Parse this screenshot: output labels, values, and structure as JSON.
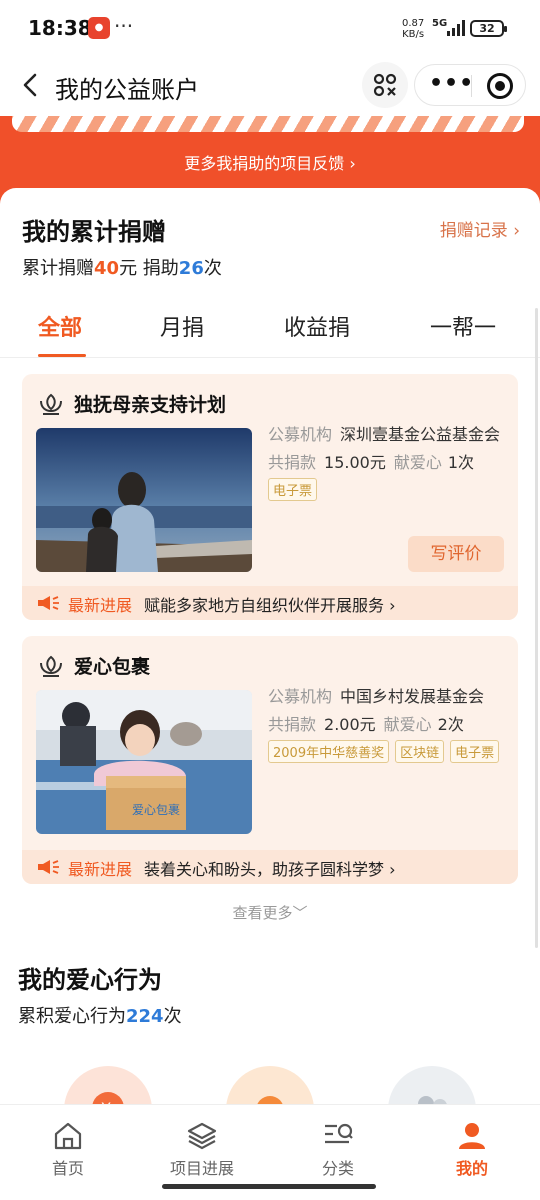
{
  "status": {
    "time": "18:38",
    "net_speed": "0.87",
    "net_unit": "KB/s",
    "net_type": "5G",
    "battery": "32",
    "dots": "···"
  },
  "nav": {
    "title": "我的公益账户",
    "back_icon": "chevron-left-icon",
    "more": "•••"
  },
  "header": {
    "feedback_link": "更多我捐助的项目反馈 ›"
  },
  "summary": {
    "title": "我的累计捐赠",
    "record_link": "捐赠记录 ›",
    "total_prefix": "累计捐赠",
    "total_amount": "40",
    "total_unit": "元",
    "times_prefix": "捐助",
    "times_count": "26",
    "times_unit": "次"
  },
  "tabs": [
    {
      "label": "全部",
      "active": true
    },
    {
      "label": "月捐",
      "active": false
    },
    {
      "label": "收益捐",
      "active": false
    },
    {
      "label": "一帮一",
      "active": false
    }
  ],
  "projects": [
    {
      "title": "独抚母亲支持计划",
      "org_label": "公募机构",
      "org_name": "深圳壹基金公益基金会",
      "donated_label": "共捐款",
      "donated_amount": "15.00元",
      "love_label": "献爱心",
      "love_count": "1次",
      "tags": [
        "电子票"
      ],
      "review_button": "写评价",
      "progress_label": "最新进展",
      "progress_text": "赋能多家地方自组织伙伴开展服务 ›"
    },
    {
      "title": "爱心包裹",
      "org_label": "公募机构",
      "org_name": "中国乡村发展基金会",
      "donated_label": "共捐款",
      "donated_amount": "2.00元",
      "love_label": "献爱心",
      "love_count": "2次",
      "tags": [
        "2009年中华慈善奖",
        "区块链",
        "电子票"
      ],
      "progress_label": "最新进展",
      "progress_text": "装着关心和盼头，助孩子圆科学梦 ›"
    }
  ],
  "see_more": "查看更多﹀",
  "love_actions": {
    "title": "我的爱心行为",
    "prefix": "累积爱心行为",
    "count": "224",
    "unit": "次"
  },
  "tab_bar": [
    {
      "label": "首页",
      "icon": "home-icon",
      "active": false
    },
    {
      "label": "项目进展",
      "icon": "layers-icon",
      "active": false
    },
    {
      "label": "分类",
      "icon": "category-search-icon",
      "active": false
    },
    {
      "label": "我的",
      "icon": "person-icon",
      "active": true
    }
  ],
  "colors": {
    "brand": "#f05a22",
    "header": "#f0502a",
    "card": "#fdf1e9",
    "blue": "#2e7bd8"
  }
}
